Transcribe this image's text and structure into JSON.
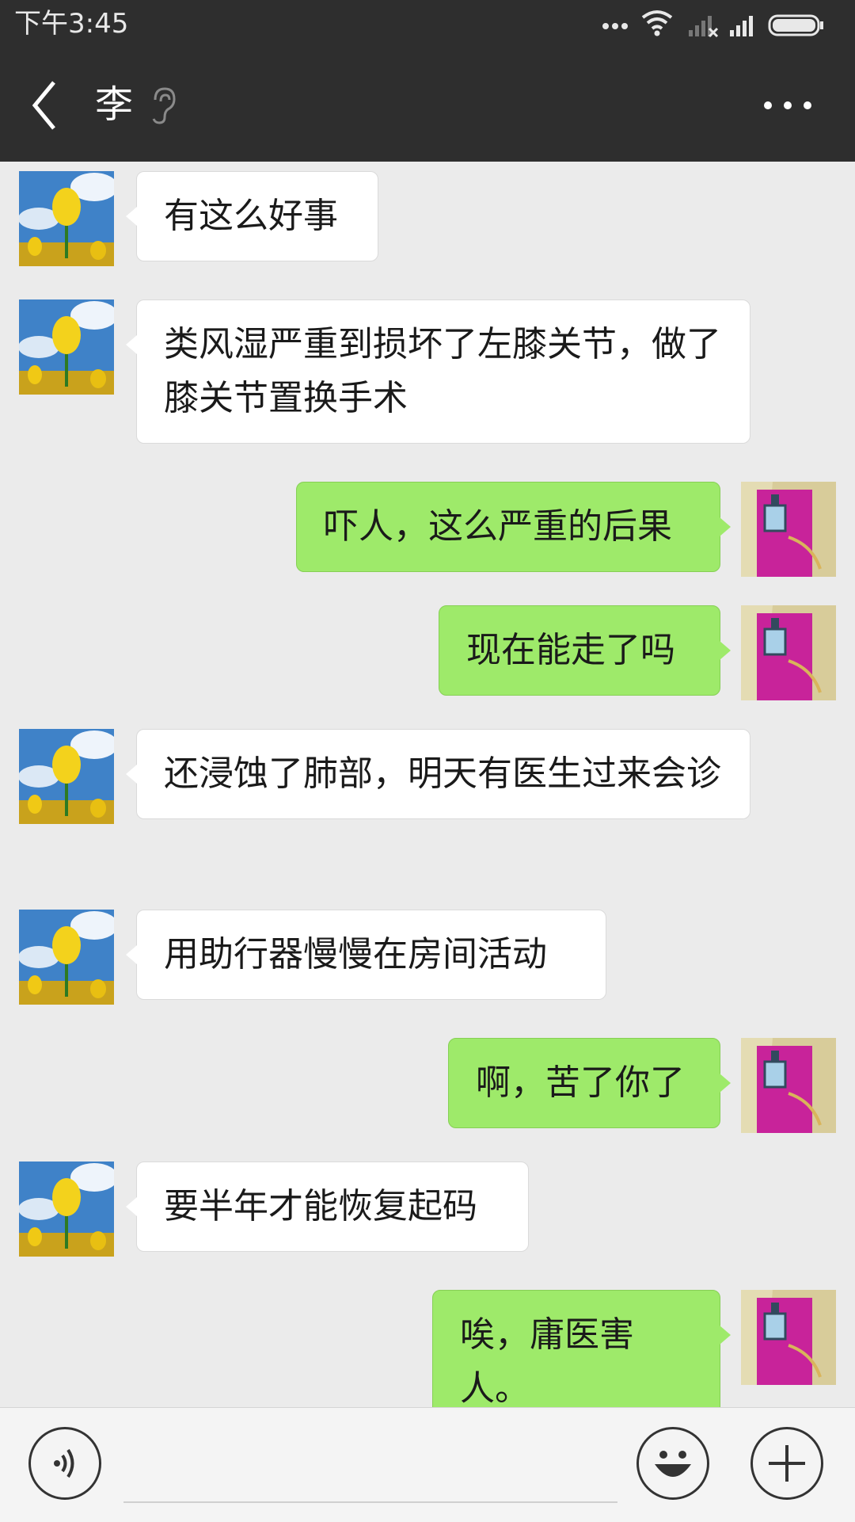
{
  "status_bar": {
    "time": "下午3:45",
    "icons": [
      "more-dots-icon",
      "wifi-icon",
      "signal-no-sim-icon",
      "signal-icon",
      "battery-icon"
    ]
  },
  "header": {
    "title": "李",
    "earpiece_icon": "ear-icon",
    "back_icon": "chevron-left-icon",
    "more_icon": "more-icon"
  },
  "colors": {
    "header_bg": "#2e2e2e",
    "chat_bg": "#ebebeb",
    "sent_bubble": "#9eea6a",
    "received_bubble": "#ffffff"
  },
  "messages": [
    {
      "side": "left",
      "text": "有这么好事"
    },
    {
      "side": "left",
      "text": "类风湿严重到损坏了左膝关节，做了膝关节置换手术"
    },
    {
      "side": "right",
      "text": "吓人，这么严重的后果"
    },
    {
      "side": "right",
      "text": "现在能走了吗"
    },
    {
      "side": "left",
      "text": "还浸蚀了肺部，明天有医生过来会诊"
    },
    {
      "side": "left",
      "text": "用助行器慢慢在房间活动"
    },
    {
      "side": "right",
      "text": "啊，苦了你了"
    },
    {
      "side": "left",
      "text": "要半年才能恢复起码"
    },
    {
      "side": "right",
      "text": "唉，庸医害人。"
    }
  ],
  "bottom_bar": {
    "voice_icon": "voice-icon",
    "emoji_icon": "emoji-icon",
    "plus_icon": "plus-icon"
  }
}
